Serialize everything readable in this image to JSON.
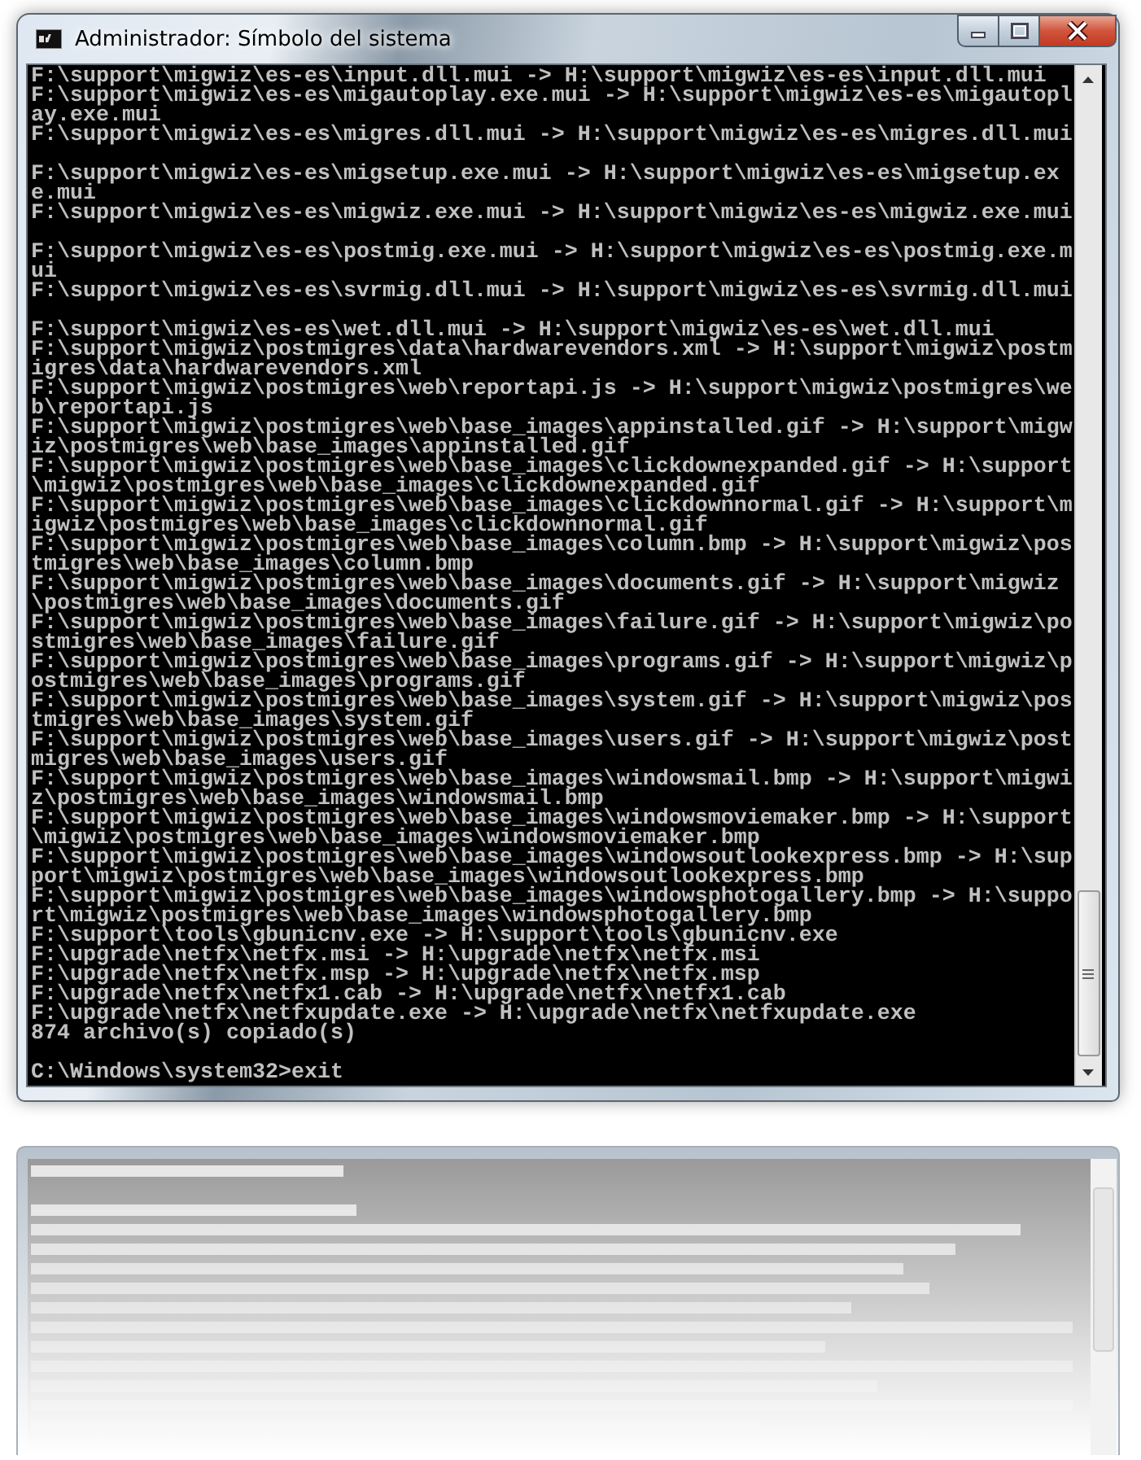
{
  "window": {
    "title": "Administrador: Símbolo del sistema",
    "controls": [
      {
        "kind": "minimize"
      },
      {
        "kind": "maximize"
      },
      {
        "kind": "close"
      }
    ]
  },
  "console": {
    "lines": [
      {
        "text": "F:\\support\\migwiz\\es-es\\input.dll.mui -> H:\\support\\migwiz\\es-es\\input.dll.mui",
        "blank_after": false
      },
      {
        "text": "F:\\support\\migwiz\\es-es\\migautoplay.exe.mui -> H:\\support\\migwiz\\es-es\\migautoplay.exe.mui",
        "blank_after": false
      },
      {
        "text": "F:\\support\\migwiz\\es-es\\migres.dll.mui -> H:\\support\\migwiz\\es-es\\migres.dll.mui",
        "blank_after": true
      },
      {
        "text": "F:\\support\\migwiz\\es-es\\migsetup.exe.mui -> H:\\support\\migwiz\\es-es\\migsetup.exe.mui",
        "blank_after": false
      },
      {
        "text": "F:\\support\\migwiz\\es-es\\migwiz.exe.mui -> H:\\support\\migwiz\\es-es\\migwiz.exe.mui",
        "blank_after": true
      },
      {
        "text": "F:\\support\\migwiz\\es-es\\postmig.exe.mui -> H:\\support\\migwiz\\es-es\\postmig.exe.mui",
        "blank_after": false
      },
      {
        "text": "F:\\support\\migwiz\\es-es\\svrmig.dll.mui -> H:\\support\\migwiz\\es-es\\svrmig.dll.mui",
        "blank_after": true
      },
      {
        "text": "F:\\support\\migwiz\\es-es\\wet.dll.mui -> H:\\support\\migwiz\\es-es\\wet.dll.mui",
        "blank_after": false
      },
      {
        "text": "F:\\support\\migwiz\\postmigres\\data\\hardwarevendors.xml -> H:\\support\\migwiz\\postmigres\\data\\hardwarevendors.xml",
        "blank_after": false
      },
      {
        "text": "F:\\support\\migwiz\\postmigres\\web\\reportapi.js -> H:\\support\\migwiz\\postmigres\\web\\reportapi.js",
        "blank_after": false
      },
      {
        "text": "F:\\support\\migwiz\\postmigres\\web\\base_images\\appinstalled.gif -> H:\\support\\migwiz\\postmigres\\web\\base_images\\appinstalled.gif",
        "blank_after": false
      },
      {
        "text": "F:\\support\\migwiz\\postmigres\\web\\base_images\\clickdownexpanded.gif -> H:\\support\\migwiz\\postmigres\\web\\base_images\\clickdownexpanded.gif",
        "blank_after": false
      },
      {
        "text": "F:\\support\\migwiz\\postmigres\\web\\base_images\\clickdownnormal.gif -> H:\\support\\migwiz\\postmigres\\web\\base_images\\clickdownnormal.gif",
        "blank_after": false
      },
      {
        "text": "F:\\support\\migwiz\\postmigres\\web\\base_images\\column.bmp -> H:\\support\\migwiz\\postmigres\\web\\base_images\\column.bmp",
        "blank_after": false
      },
      {
        "text": "F:\\support\\migwiz\\postmigres\\web\\base_images\\documents.gif -> H:\\support\\migwiz\\postmigres\\web\\base_images\\documents.gif",
        "blank_after": false
      },
      {
        "text": "F:\\support\\migwiz\\postmigres\\web\\base_images\\failure.gif -> H:\\support\\migwiz\\postmigres\\web\\base_images\\failure.gif",
        "blank_after": false
      },
      {
        "text": "F:\\support\\migwiz\\postmigres\\web\\base_images\\programs.gif -> H:\\support\\migwiz\\postmigres\\web\\base_images\\programs.gif",
        "blank_after": false
      },
      {
        "text": "F:\\support\\migwiz\\postmigres\\web\\base_images\\system.gif -> H:\\support\\migwiz\\postmigres\\web\\base_images\\system.gif",
        "blank_after": false
      },
      {
        "text": "F:\\support\\migwiz\\postmigres\\web\\base_images\\users.gif -> H:\\support\\migwiz\\postmigres\\web\\base_images\\users.gif",
        "blank_after": false
      },
      {
        "text": "F:\\support\\migwiz\\postmigres\\web\\base_images\\windowsmail.bmp -> H:\\support\\migwiz\\postmigres\\web\\base_images\\windowsmail.bmp",
        "blank_after": false
      },
      {
        "text": "F:\\support\\migwiz\\postmigres\\web\\base_images\\windowsmoviemaker.bmp -> H:\\support\\migwiz\\postmigres\\web\\base_images\\windowsmoviemaker.bmp",
        "blank_after": false
      },
      {
        "text": "F:\\support\\migwiz\\postmigres\\web\\base_images\\windowsoutlookexpress.bmp -> H:\\support\\migwiz\\postmigres\\web\\base_images\\windowsoutlookexpress.bmp",
        "blank_after": false
      },
      {
        "text": "F:\\support\\migwiz\\postmigres\\web\\base_images\\windowsphotogallery.bmp -> H:\\support\\migwiz\\postmigres\\web\\base_images\\windowsphotogallery.bmp",
        "blank_after": false
      },
      {
        "text": "F:\\support\\tools\\gbunicnv.exe -> H:\\support\\tools\\gbunicnv.exe",
        "blank_after": false
      },
      {
        "text": "F:\\upgrade\\netfx\\netfx.msi -> H:\\upgrade\\netfx\\netfx.msi",
        "blank_after": false
      },
      {
        "text": "F:\\upgrade\\netfx\\netfx.msp -> H:\\upgrade\\netfx\\netfx.msp",
        "blank_after": false
      },
      {
        "text": "F:\\upgrade\\netfx\\netfx1.cab -> H:\\upgrade\\netfx\\netfx1.cab",
        "blank_after": false
      },
      {
        "text": "F:\\upgrade\\netfx\\netfxupdate.exe -> H:\\upgrade\\netfx\\netfxupdate.exe",
        "blank_after": false
      },
      {
        "text": "874 archivo(s) copiado(s)",
        "blank_after": true
      },
      {
        "text": "C:\\Windows\\system32>exit",
        "blank_after": false
      }
    ]
  }
}
